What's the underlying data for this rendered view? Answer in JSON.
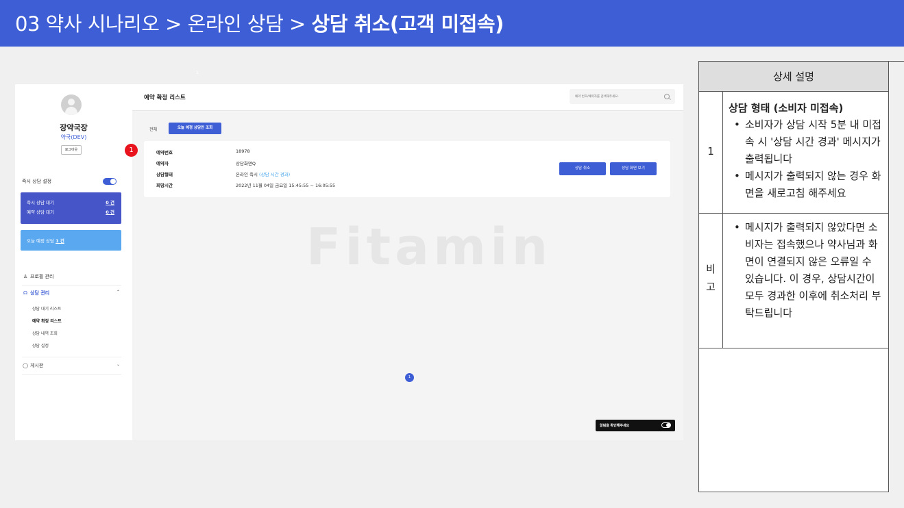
{
  "header": {
    "title_prefix": "03 약사 시나리오 > 온라인 상담 > ",
    "title_bold": "상담 취소(고객 미접속)"
  },
  "sidebar": {
    "pharmacy_name": "장약국장",
    "pharmacy_sub": "약국(DEV)",
    "logout_label": "로그아웃",
    "instant_setting_label": "즉시 상담 설정",
    "instant_wait_label": "즉시 상담 대기",
    "instant_wait_value": "0 건",
    "reserve_wait_label": "예약 상담 대기",
    "reserve_wait_value": "0 건",
    "today_label": "오늘 예정 상담",
    "today_value": "1 건",
    "nav": {
      "profile": "프로필 관리",
      "consult": "상담 관리",
      "sub_wait_list": "상담 대기 리스트",
      "sub_confirmed_list": "예약 확정 리스트",
      "sub_history": "상담 내역 조회",
      "sub_settings": "상담 설정",
      "board": "게시판"
    }
  },
  "main": {
    "title": "예약 확정 리스트",
    "search_placeholder": "예약 번호/예약자를 검색해주세요.",
    "filter_all": "전체",
    "filter_today": "오늘 예정 상담만 조회",
    "card": {
      "reservation_no_label": "예약번호",
      "reservation_no": "18978",
      "reserver_label": "예약자",
      "reserver": "상담화면Q",
      "type_label": "상담형태",
      "type_value": "온라인 즉시",
      "type_warning": "(상담 시간 경과)",
      "time_label": "희망시간",
      "time_value": "2022년 11월 04일 금요일 15:45:55 ~ 16:05:55",
      "cancel_button": "상담 취소",
      "view_button": "상담 화면 보기"
    },
    "watermark": "Fitamin",
    "page_number": "1",
    "alarm_text": "알림을 확인해주세요",
    "badge": "1",
    "tiny_marker": "1"
  },
  "panel": {
    "header": "상세 설명",
    "row1_number": "1",
    "row1_title": "상담 형태 (소비자 미접속)",
    "row1_bullets": [
      "소비자가 상담 시작 5분 내 미접속 시 '상담 시간 경과' 메시지가 출력됩니다",
      "메시지가 출력되지 않는 경우 화면을 새로고침 해주세요"
    ],
    "row2_label": "비고",
    "row2_bullets": [
      "메시지가 출력되지 않았다면 소비자는 접속했으나 약사님과 화면이 연결되지 않은 오류일 수 있습니다. 이 경우, 상담시간이 모두 경과한 이후에 취소처리 부탁드립니다"
    ]
  },
  "colors": {
    "brand_blue": "#3e5ed6",
    "sky_blue": "#5aa8f0",
    "badge_red": "#e8131c"
  },
  "icons": [
    "avatar-icon",
    "toggle-icon",
    "profile-icon",
    "headset-icon",
    "chevron-up-icon",
    "chat-icon",
    "chevron-down-icon",
    "search-icon",
    "alarm-toggle-icon"
  ]
}
